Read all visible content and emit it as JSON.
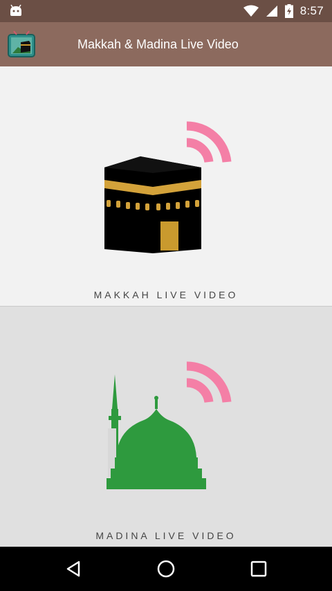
{
  "status_bar": {
    "time": "8:57",
    "left_icon": "android-icon",
    "icons": [
      "wifi-icon",
      "signal-icon",
      "battery-charging-icon"
    ]
  },
  "app_bar": {
    "title": "Makkah & Madina Live Video",
    "logo_icon": "kaaba-tv-logo-icon"
  },
  "panels": [
    {
      "label": "MAKKAH LIVE VIDEO",
      "icon": "kaaba-icon",
      "badge_icon": "live-signal-icon"
    },
    {
      "label": "MADINA LIVE VIDEO",
      "icon": "green-dome-icon",
      "badge_icon": "live-signal-icon"
    }
  ],
  "nav_bar": {
    "buttons": [
      "back-icon",
      "home-icon",
      "recents-icon"
    ]
  },
  "colors": {
    "status_bar": "#6b4f45",
    "app_bar": "#8c6a5e",
    "signal_pink": "#f47fa6",
    "dome_green": "#2e9a3e",
    "kaaba_gold": "#c99a2e"
  }
}
